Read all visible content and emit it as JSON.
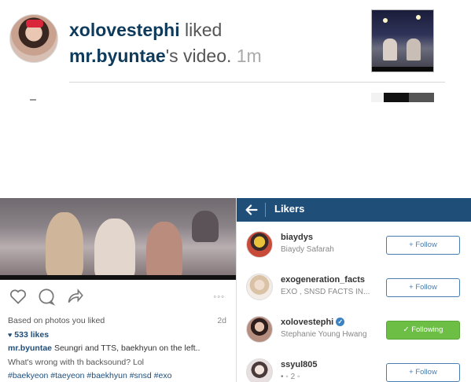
{
  "notification": {
    "username": "xolovestephi",
    "action_text": " liked",
    "target_user": "mr.byuntae",
    "target_suffix": "'s video.",
    "time": "1m"
  },
  "post": {
    "actions": {
      "more": "◦◦◦"
    },
    "suggestion": "Based on photos you liked",
    "date": "2d",
    "likes": "533 likes",
    "caption_user": "mr.byuntae",
    "caption_text": "Seungri and TTS, baekhyun on the left..",
    "comment": "What's wrong with th backsound? Lol",
    "hashtags": "#baekyeon #taeyeon #baekhyun #snsd #exo"
  },
  "likers": {
    "title": "Likers",
    "items": [
      {
        "username": "biaydys",
        "full_name": "Biaydy Safarah",
        "button": "+ Follow",
        "following": false
      },
      {
        "username": "exogeneration_facts",
        "full_name": "EXO , SNSD FACTS IN...",
        "button": "+ Follow",
        "following": false
      },
      {
        "username": "xolovestephi",
        "full_name": "Stephanie Young Hwang",
        "button": "✓ Following",
        "following": true,
        "verified": true
      },
      {
        "username": "ssyul805",
        "full_name": "• ◦ 2 ◦",
        "button": "+ Follow",
        "following": false
      }
    ]
  },
  "colors": {
    "accent": "#1f4e79",
    "following_green": "#6cbe45",
    "link_blue": "#0e3a5c"
  }
}
